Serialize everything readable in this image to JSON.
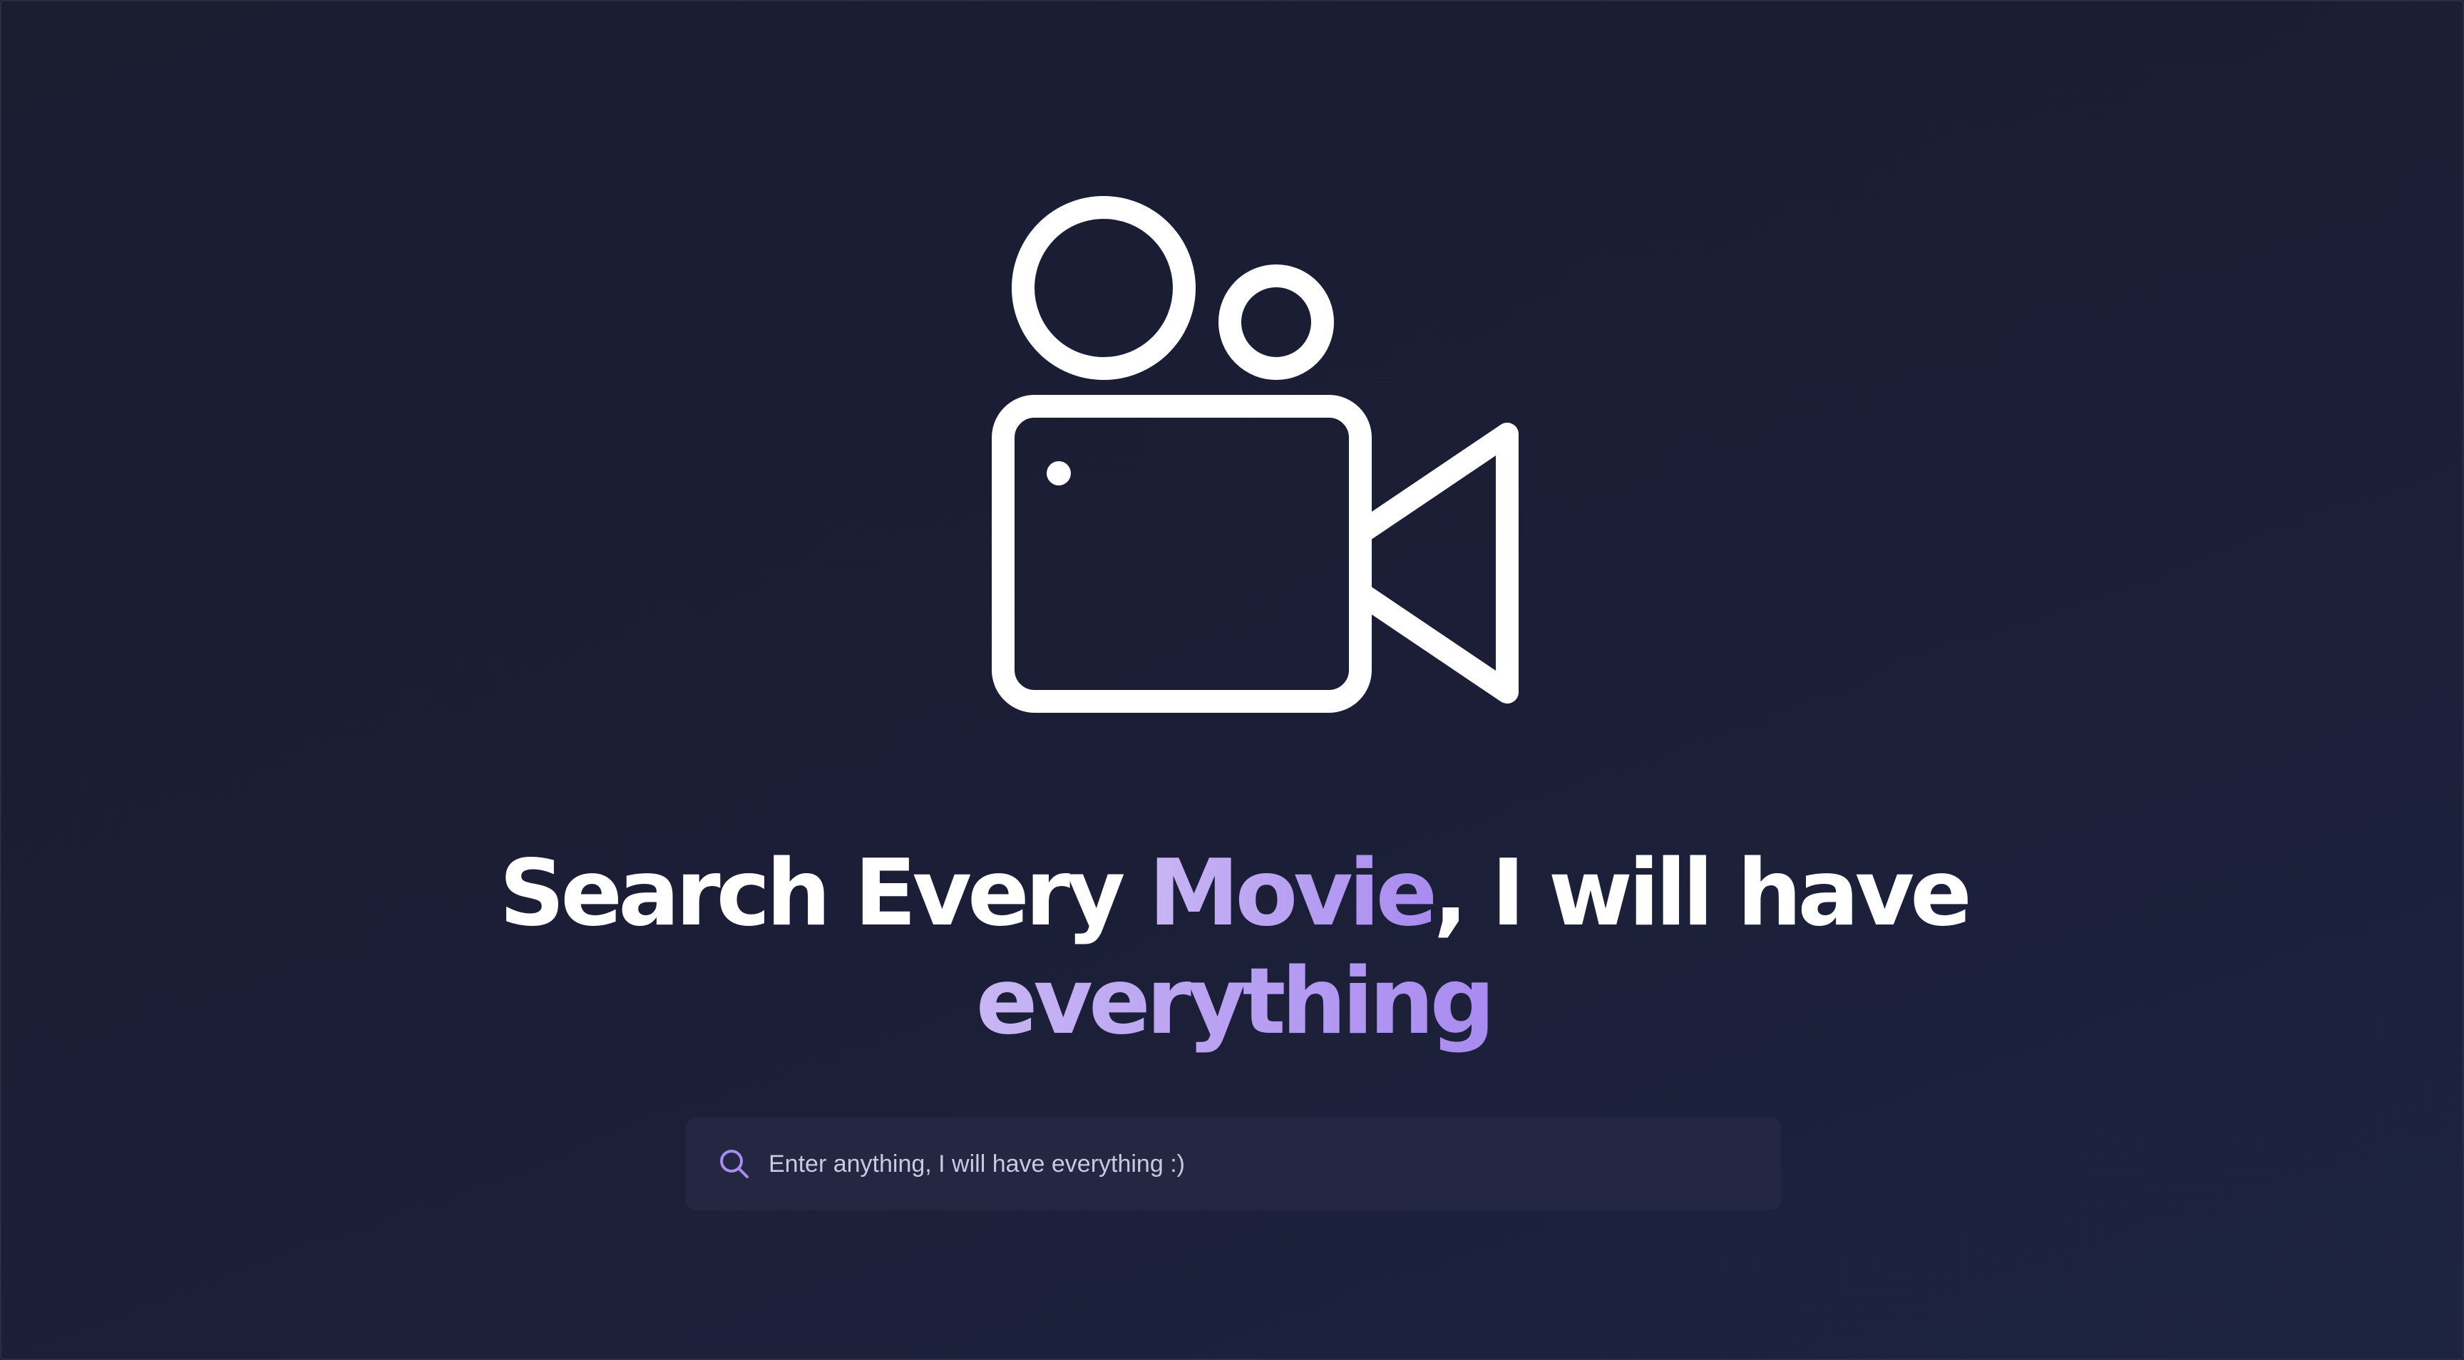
{
  "hero": {
    "icon": "video-camera-icon",
    "headline": {
      "part1": "Search Every ",
      "accent1": "Movie",
      "part2": ", I will have",
      "accent2": "everything"
    }
  },
  "search": {
    "icon": "search-icon",
    "value": "",
    "placeholder": "Enter anything, I will have everything :)"
  },
  "colors": {
    "background": "#1b1e36",
    "accent": "#b39cf2",
    "text": "#ffffff",
    "search_background": "#232741"
  }
}
